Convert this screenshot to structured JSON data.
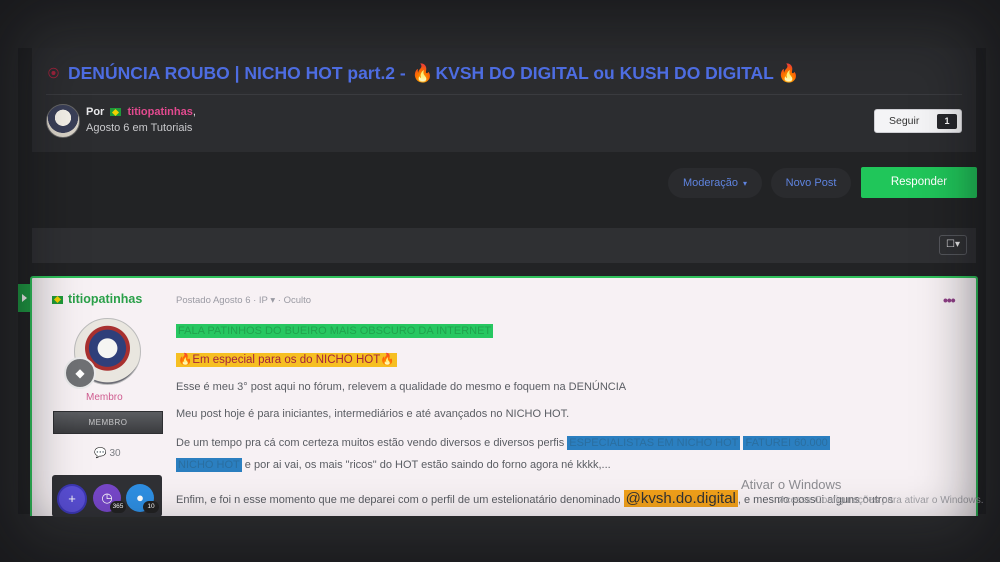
{
  "thread": {
    "title_prefix": "DENÚNCIA ROUBO | NICHO HOT part.2 -",
    "title_mid": "KVSH DO DIGITAL ou KUSH DO DIGITAL",
    "fire": "🔥",
    "hidden_icon": "eye-slash-icon",
    "by_label": "Por",
    "author": "titiopatinhas",
    "author_suffix": ",",
    "date_category": "Agosto 6 em Tutoriais"
  },
  "follow": {
    "label": "Seguir",
    "count": "1"
  },
  "actions": {
    "moderation_label": "Moderação",
    "moderation_caret": "▾",
    "new_post_label": "Novo Post",
    "reply_label": "Responder"
  },
  "filter_icon_label": "☐▾",
  "post": {
    "author_name": "titiopatinhas",
    "member_title": "Membro",
    "group_label": "MEMBRO",
    "post_count": "30",
    "comment_glyph": "💬",
    "badges": [
      {
        "name": "plus-badge",
        "glyph": "+",
        "count": ""
      },
      {
        "name": "clock-badge",
        "glyph": "◷",
        "count": "365"
      },
      {
        "name": "comment-badge",
        "glyph": "●",
        "count": "10"
      }
    ],
    "meta": "Postado Agosto 6 · IP ▾ · Oculto",
    "menu_glyph": "•••",
    "lines": {
      "l1": "FALA PATINHOS DO BUEIRO MAIS OBSCURO DA INTERNET",
      "l2": "🔥Em especial para os do NICHO HOT🔥",
      "l3": "Esse é meu 3° post aqui no fórum, relevem a qualidade do mesmo e foquem na DENÚNCIA",
      "l4": "Meu post hoje é para iniciantes, intermediários e até avançados no NICHO HOT.",
      "l5_a": "De um tempo pra cá com certeza muitos estão vendo diversos e diversos perfis",
      "l5_b": "ESPECIALISTAS EM NICHO HOT",
      "l5_c": "FATUREI 60.000",
      "l6_a": "NICHO HOT",
      "l6_b": "e por ai vai, os mais \"ricos\" do HOT estão saindo do forno agora né kkkk,...",
      "l7_a": "Enfim, e foi n esse momento que me deparei com o perfil de um estelionatário denominado",
      "l7_b": "@kvsh.do.digital",
      "l7_c": ", e mesmo possui alguns outros"
    }
  },
  "watermark": {
    "line1": "Ativar o Windows",
    "line2": "Acesse Configurações para ativar o Windows."
  }
}
